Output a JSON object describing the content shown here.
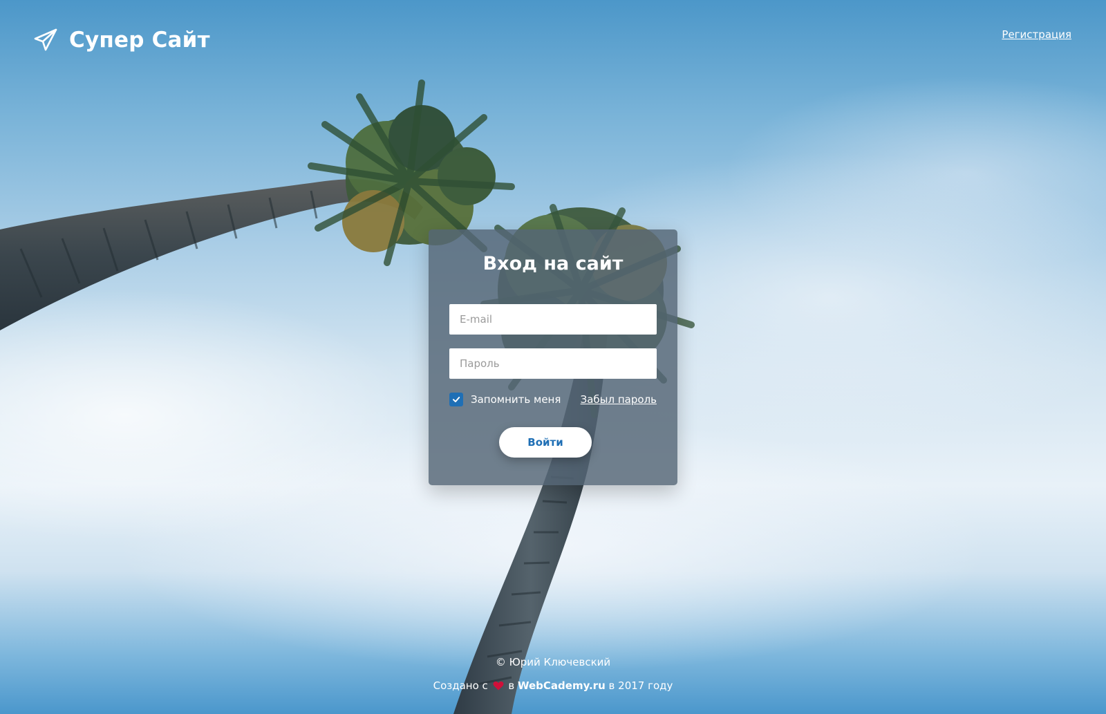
{
  "header": {
    "logo_icon": "paper-plane-icon",
    "site_name": "Супер Сайт",
    "register_link": "Регистрация"
  },
  "login": {
    "title": "Вход на сайт",
    "email_placeholder": "E-mail",
    "email_value": "",
    "password_placeholder": "Пароль",
    "password_value": "",
    "remember_label": "Запомнить меня",
    "remember_checked": true,
    "forgot_link": "Забыл пароль",
    "submit_label": "Войти"
  },
  "footer": {
    "copyright": "© Юрий Ключевский",
    "created_prefix": "Создано с",
    "heart_icon": "heart-icon",
    "created_middle": "в",
    "brand": "WebCademy.ru",
    "created_suffix": "в 2017 году"
  },
  "colors": {
    "accent": "#1f6fb5",
    "card_background": "#546575",
    "heart": "#d0103a"
  }
}
